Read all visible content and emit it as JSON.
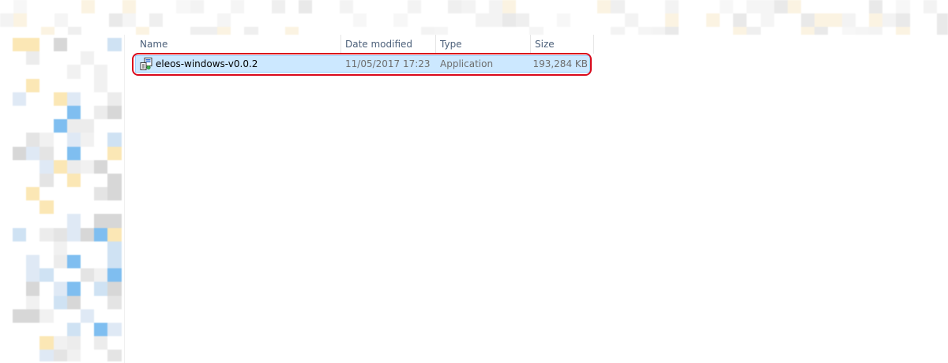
{
  "window": {
    "obscured_regions": [
      "toolbar",
      "navigation-pane"
    ]
  },
  "file_list": {
    "columns": [
      {
        "key": "name",
        "label": "Name"
      },
      {
        "key": "date_modified",
        "label": "Date modified"
      },
      {
        "key": "type",
        "label": "Type"
      },
      {
        "key": "size",
        "label": "Size"
      }
    ],
    "rows": [
      {
        "name": "eleos-windows-v0.0.2",
        "date_modified": "11/05/2017 17:23",
        "type": "Application",
        "size": "193,284 KB",
        "icon": "application-installer-icon",
        "selected": true,
        "highlighted": true
      }
    ]
  },
  "colors": {
    "selection_fill": "#cce8ff",
    "selection_border": "#99d1ff",
    "highlight_ring": "#d90a1c",
    "header_text": "#4c607a",
    "secondary_text": "#6d6d6d"
  }
}
